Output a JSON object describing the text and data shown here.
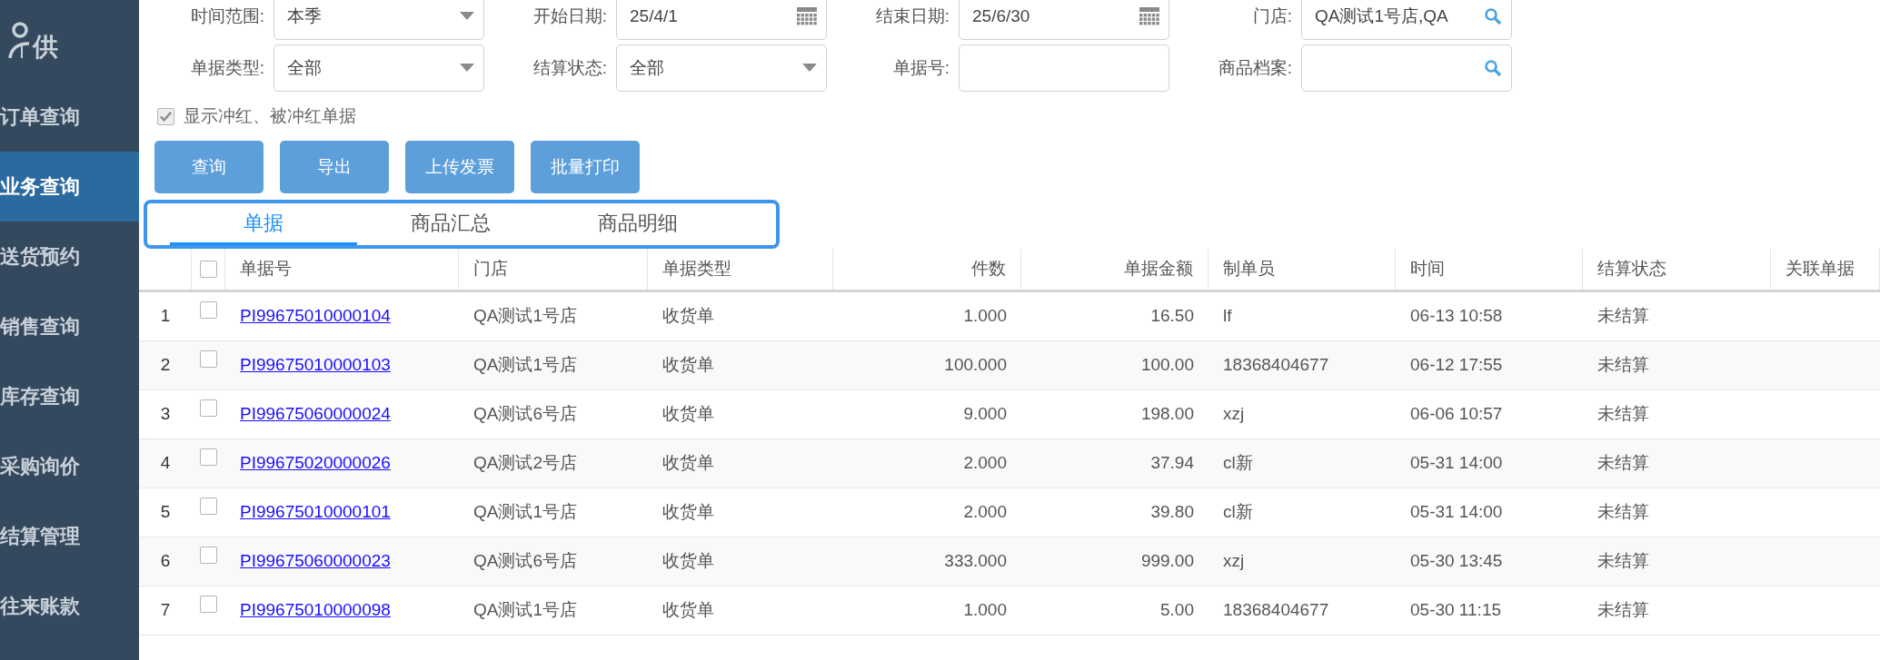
{
  "sidebar": {
    "logo_text": "供",
    "items": [
      {
        "label": "订单查询",
        "selected": false
      },
      {
        "label": "业务查询",
        "selected": true
      },
      {
        "label": "送货预约",
        "selected": false
      },
      {
        "label": "销售查询",
        "selected": false
      },
      {
        "label": "库存查询",
        "selected": false
      },
      {
        "label": "采购询价",
        "selected": false
      },
      {
        "label": "结算管理",
        "selected": false
      },
      {
        "label": "往来账款",
        "selected": false
      }
    ]
  },
  "filters": [
    {
      "label": "时间范围:",
      "kind": "select",
      "value": "本季"
    },
    {
      "label": "开始日期:",
      "kind": "date",
      "value": "25/4/1"
    },
    {
      "label": "结束日期:",
      "kind": "date",
      "value": "25/6/30"
    },
    {
      "label": "门店:",
      "kind": "lookup",
      "value": "QA测试1号店,QA"
    },
    {
      "label": "单据类型:",
      "kind": "select",
      "value": "全部"
    },
    {
      "label": "结算状态:",
      "kind": "select",
      "value": "全部"
    },
    {
      "label": "单据号:",
      "kind": "text"
    },
    {
      "label": "商品档案:",
      "kind": "lookup"
    }
  ],
  "show_reversed": {
    "label": "显示冲红、被冲红单据",
    "checked": true
  },
  "buttons": [
    "查询",
    "导出",
    "上传发票",
    "批量打印"
  ],
  "tabs": [
    {
      "label": "单据",
      "selected": true
    },
    {
      "label": "商品汇总",
      "selected": false
    },
    {
      "label": "商品明细",
      "selected": false
    }
  ],
  "table": {
    "header_checked": false,
    "columns": [
      "单据号",
      "门店",
      "单据类型",
      "件数",
      "单据金额",
      "制单员",
      "时间",
      "结算状态",
      "关联单据"
    ],
    "rows": [
      {
        "index": "1",
        "checked": false,
        "cells": [
          "PI99675010000104",
          "QA测试1号店",
          "收货单",
          "1.000",
          "16.50",
          "lf",
          "06-13 10:58",
          "未结算"
        ]
      },
      {
        "index": "2",
        "checked": false,
        "cells": [
          "PI99675010000103",
          "QA测试1号店",
          "收货单",
          "100.000",
          "100.00",
          "18368404677",
          "06-12 17:55",
          "未结算"
        ]
      },
      {
        "index": "3",
        "checked": false,
        "cells": [
          "PI99675060000024",
          "QA测试6号店",
          "收货单",
          "9.000",
          "198.00",
          "xzj",
          "06-06 10:57",
          "未结算"
        ]
      },
      {
        "index": "4",
        "checked": false,
        "cells": [
          "PI99675020000026",
          "QA测试2号店",
          "收货单",
          "2.000",
          "37.94",
          "cl新",
          "05-31 14:00",
          "未结算"
        ]
      },
      {
        "index": "5",
        "checked": false,
        "cells": [
          "PI99675010000101",
          "QA测试1号店",
          "收货单",
          "2.000",
          "39.80",
          "cl新",
          "05-31 14:00",
          "未结算"
        ]
      },
      {
        "index": "6",
        "checked": false,
        "cells": [
          "PI99675060000023",
          "QA测试6号店",
          "收货单",
          "333.000",
          "999.00",
          "xzj",
          "05-30 13:45",
          "未结算"
        ]
      },
      {
        "index": "7",
        "checked": false,
        "cells": [
          "PI99675010000098",
          "QA测试1号店",
          "收货单",
          "1.000",
          "5.00",
          "18368404677",
          "05-30 11:15",
          "未结算"
        ]
      }
    ]
  }
}
